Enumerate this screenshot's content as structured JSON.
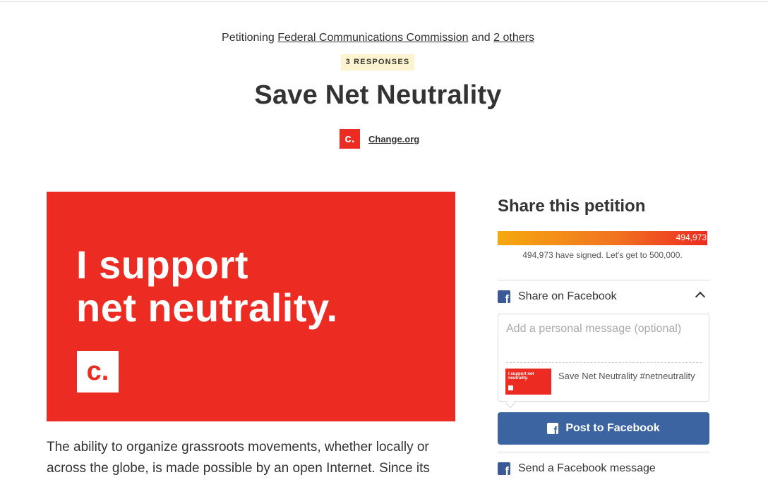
{
  "header": {
    "petitioning_prefix": "Petitioning",
    "target_link": "Federal Communications Commission",
    "and_text": "and",
    "others_link": "2 others",
    "responses_badge": "3 RESPONSES",
    "title": "Save Net Neutrality",
    "starter_logo": "c.",
    "starter_name": "Change.org"
  },
  "hero": {
    "line1": "I support",
    "line2": "net neutrality.",
    "logo_text": "c.",
    "background_color": "#ec2c22"
  },
  "body": {
    "paragraph": "The ability to organize grassroots movements, whether locally or across the globe, is made possible by an open Internet. Since its"
  },
  "share": {
    "title": "Share this petition",
    "progress_count": "494,973",
    "progress_text": "494,973 have signed. Let's get to 500,000.",
    "signatures": 494973,
    "goal": 500000,
    "share_facebook_label": "Share on Facebook",
    "message_placeholder": "Add a personal message (optional)",
    "thumbnail_text": "I support net neutrality.",
    "preview_caption": "Save Net Neutrality #netneutrality",
    "post_button_label": "Post to Facebook",
    "send_message_label": "Send a Facebook message",
    "facebook_color": "#3b5998",
    "button_color": "#3b64a0",
    "icons": [
      "facebook-icon",
      "chevron-up-icon"
    ]
  }
}
